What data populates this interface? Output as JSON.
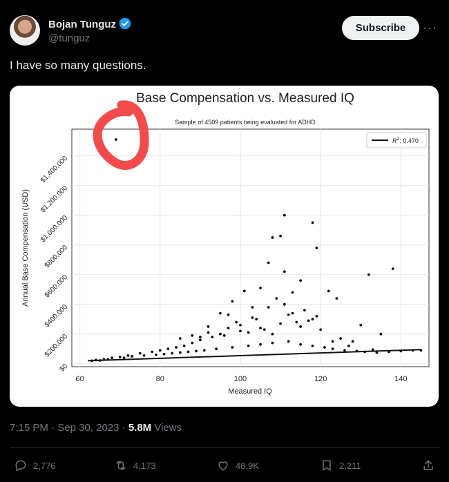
{
  "author": {
    "name": "Bojan Tunguz",
    "handle": "@tunguz",
    "subscribe_label": "Subscribe",
    "more_label": "···"
  },
  "tweet": {
    "text": "I have so many questions."
  },
  "meta": {
    "time": "7:15 PM",
    "sep1": " · ",
    "date": "Sep 30, 2023",
    "sep2": " · ",
    "views": "5.8M",
    "views_label": " Views"
  },
  "actions": {
    "replies": "2,776",
    "reposts": "4,173",
    "likes": "48.9K",
    "bookmarks": "2,211"
  },
  "colors": {
    "annotation": "#f24b4b",
    "verified": "#1d9bf0"
  },
  "chart_data": {
    "type": "scatter",
    "title": "Base Compensation vs. Measured IQ",
    "subtitle": "Sample of 4509 patients being evaluated for ADHD",
    "xlabel": "Measured IQ",
    "ylabel": "Annual Base Compensation (USD)",
    "xlim": [
      58,
      147
    ],
    "ylim": [
      -20000,
      1580000
    ],
    "xticks": [
      60,
      80,
      100,
      120,
      140
    ],
    "yticks": [
      {
        "value": 0,
        "label": "$0"
      },
      {
        "value": 200000,
        "label": "$200,000"
      },
      {
        "value": 400000,
        "label": "$400,000"
      },
      {
        "value": 600000,
        "label": "$600,000"
      },
      {
        "value": 800000,
        "label": "$800,000"
      },
      {
        "value": 1000000,
        "label": "$1,000,000"
      },
      {
        "value": 1200000,
        "label": "$1,200,000"
      },
      {
        "value": 1400000,
        "label": "$1,400,000"
      }
    ],
    "grid": true,
    "legend": {
      "placement": "top-right",
      "label_prefix": "R",
      "label_sup": "2",
      "label_suffix": ": 0.470"
    },
    "trend_line": {
      "x": [
        62,
        145
      ],
      "y": [
        20000,
        95000
      ]
    },
    "points": {
      "x": [
        69,
        111,
        118,
        108,
        110,
        119,
        111,
        107,
        132,
        138,
        105,
        101,
        115,
        122,
        124,
        130,
        135,
        113,
        98,
        103,
        109,
        111,
        116,
        119,
        104,
        99,
        95,
        92,
        97,
        100,
        112,
        114,
        118,
        106,
        102,
        108,
        96,
        93,
        120,
        125,
        128,
        90,
        88,
        86,
        84,
        82,
        80,
        78,
        75,
        72,
        70,
        68,
        66,
        64,
        63,
        65,
        67,
        71,
        73,
        76,
        79,
        81,
        83,
        85,
        87,
        89,
        91,
        94,
        98,
        102,
        105,
        108,
        112,
        115,
        118,
        121,
        123,
        126,
        129,
        131,
        134,
        137,
        140,
        143,
        145,
        110,
        115,
        100,
        105,
        95,
        90,
        85,
        107,
        113,
        117,
        103,
        97,
        92,
        88,
        123,
        127,
        133
      ],
      "y": [
        1510000,
        1000000,
        950000,
        850000,
        860000,
        780000,
        620000,
        680000,
        600000,
        640000,
        510000,
        490000,
        560000,
        490000,
        440000,
        260000,
        200000,
        480000,
        420000,
        380000,
        440000,
        400000,
        360000,
        320000,
        300000,
        280000,
        340000,
        250000,
        240000,
        260000,
        330000,
        280000,
        300000,
        230000,
        210000,
        200000,
        190000,
        180000,
        230000,
        170000,
        150000,
        160000,
        140000,
        120000,
        110000,
        100000,
        90000,
        80000,
        70000,
        55000,
        45000,
        40000,
        30000,
        25000,
        20000,
        22000,
        30000,
        40000,
        50000,
        55000,
        60000,
        65000,
        70000,
        75000,
        80000,
        85000,
        90000,
        100000,
        110000,
        120000,
        130000,
        140000,
        150000,
        130000,
        120000,
        110000,
        100000,
        90000,
        85000,
        80000,
        75000,
        80000,
        85000,
        90000,
        90000,
        270000,
        250000,
        220000,
        240000,
        200000,
        180000,
        170000,
        380000,
        340000,
        290000,
        310000,
        330000,
        210000,
        190000,
        150000,
        120000,
        95000
      ]
    }
  }
}
